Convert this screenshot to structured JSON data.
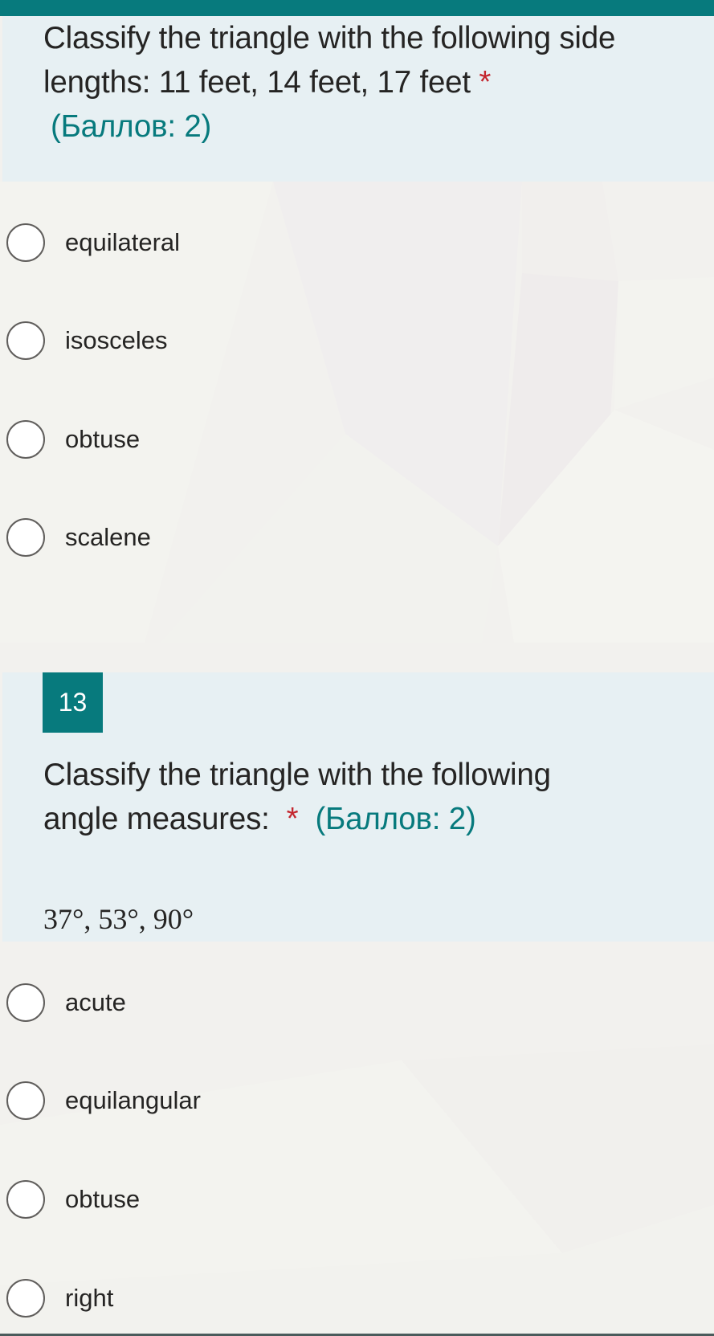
{
  "colors": {
    "accent": "#077a7d",
    "question_bg": "#e7f0f3",
    "page_bg": "#f2f1ee",
    "required": "#c4262e",
    "text": "#252423"
  },
  "questions": [
    {
      "number": "",
      "title_line1": "Classify the triangle with the following side",
      "title_line2": "lengths: 11 feet, 14 feet, 17 feet",
      "required_mark": "*",
      "points": "(Баллов: 2)",
      "options": [
        {
          "label": "equilateral",
          "selected": false,
          "icon": "radio-unchecked-icon"
        },
        {
          "label": "isosceles",
          "selected": false,
          "icon": "radio-unchecked-icon"
        },
        {
          "label": "obtuse",
          "selected": false,
          "icon": "radio-unchecked-icon"
        },
        {
          "label": "scalene",
          "selected": false,
          "icon": "radio-unchecked-icon"
        }
      ]
    },
    {
      "number": "13",
      "title_line1": "Classify the triangle with the following",
      "title_line2": "angle measures:",
      "required_mark": "*",
      "points": "(Баллов: 2)",
      "math": "37°, 53°, 90°",
      "options": [
        {
          "label": "acute",
          "selected": false,
          "icon": "radio-unchecked-icon"
        },
        {
          "label": "equilangular",
          "selected": false,
          "icon": "radio-unchecked-icon"
        },
        {
          "label": "obtuse",
          "selected": false,
          "icon": "radio-unchecked-icon"
        },
        {
          "label": "right",
          "selected": false,
          "icon": "radio-unchecked-icon"
        }
      ]
    }
  ]
}
